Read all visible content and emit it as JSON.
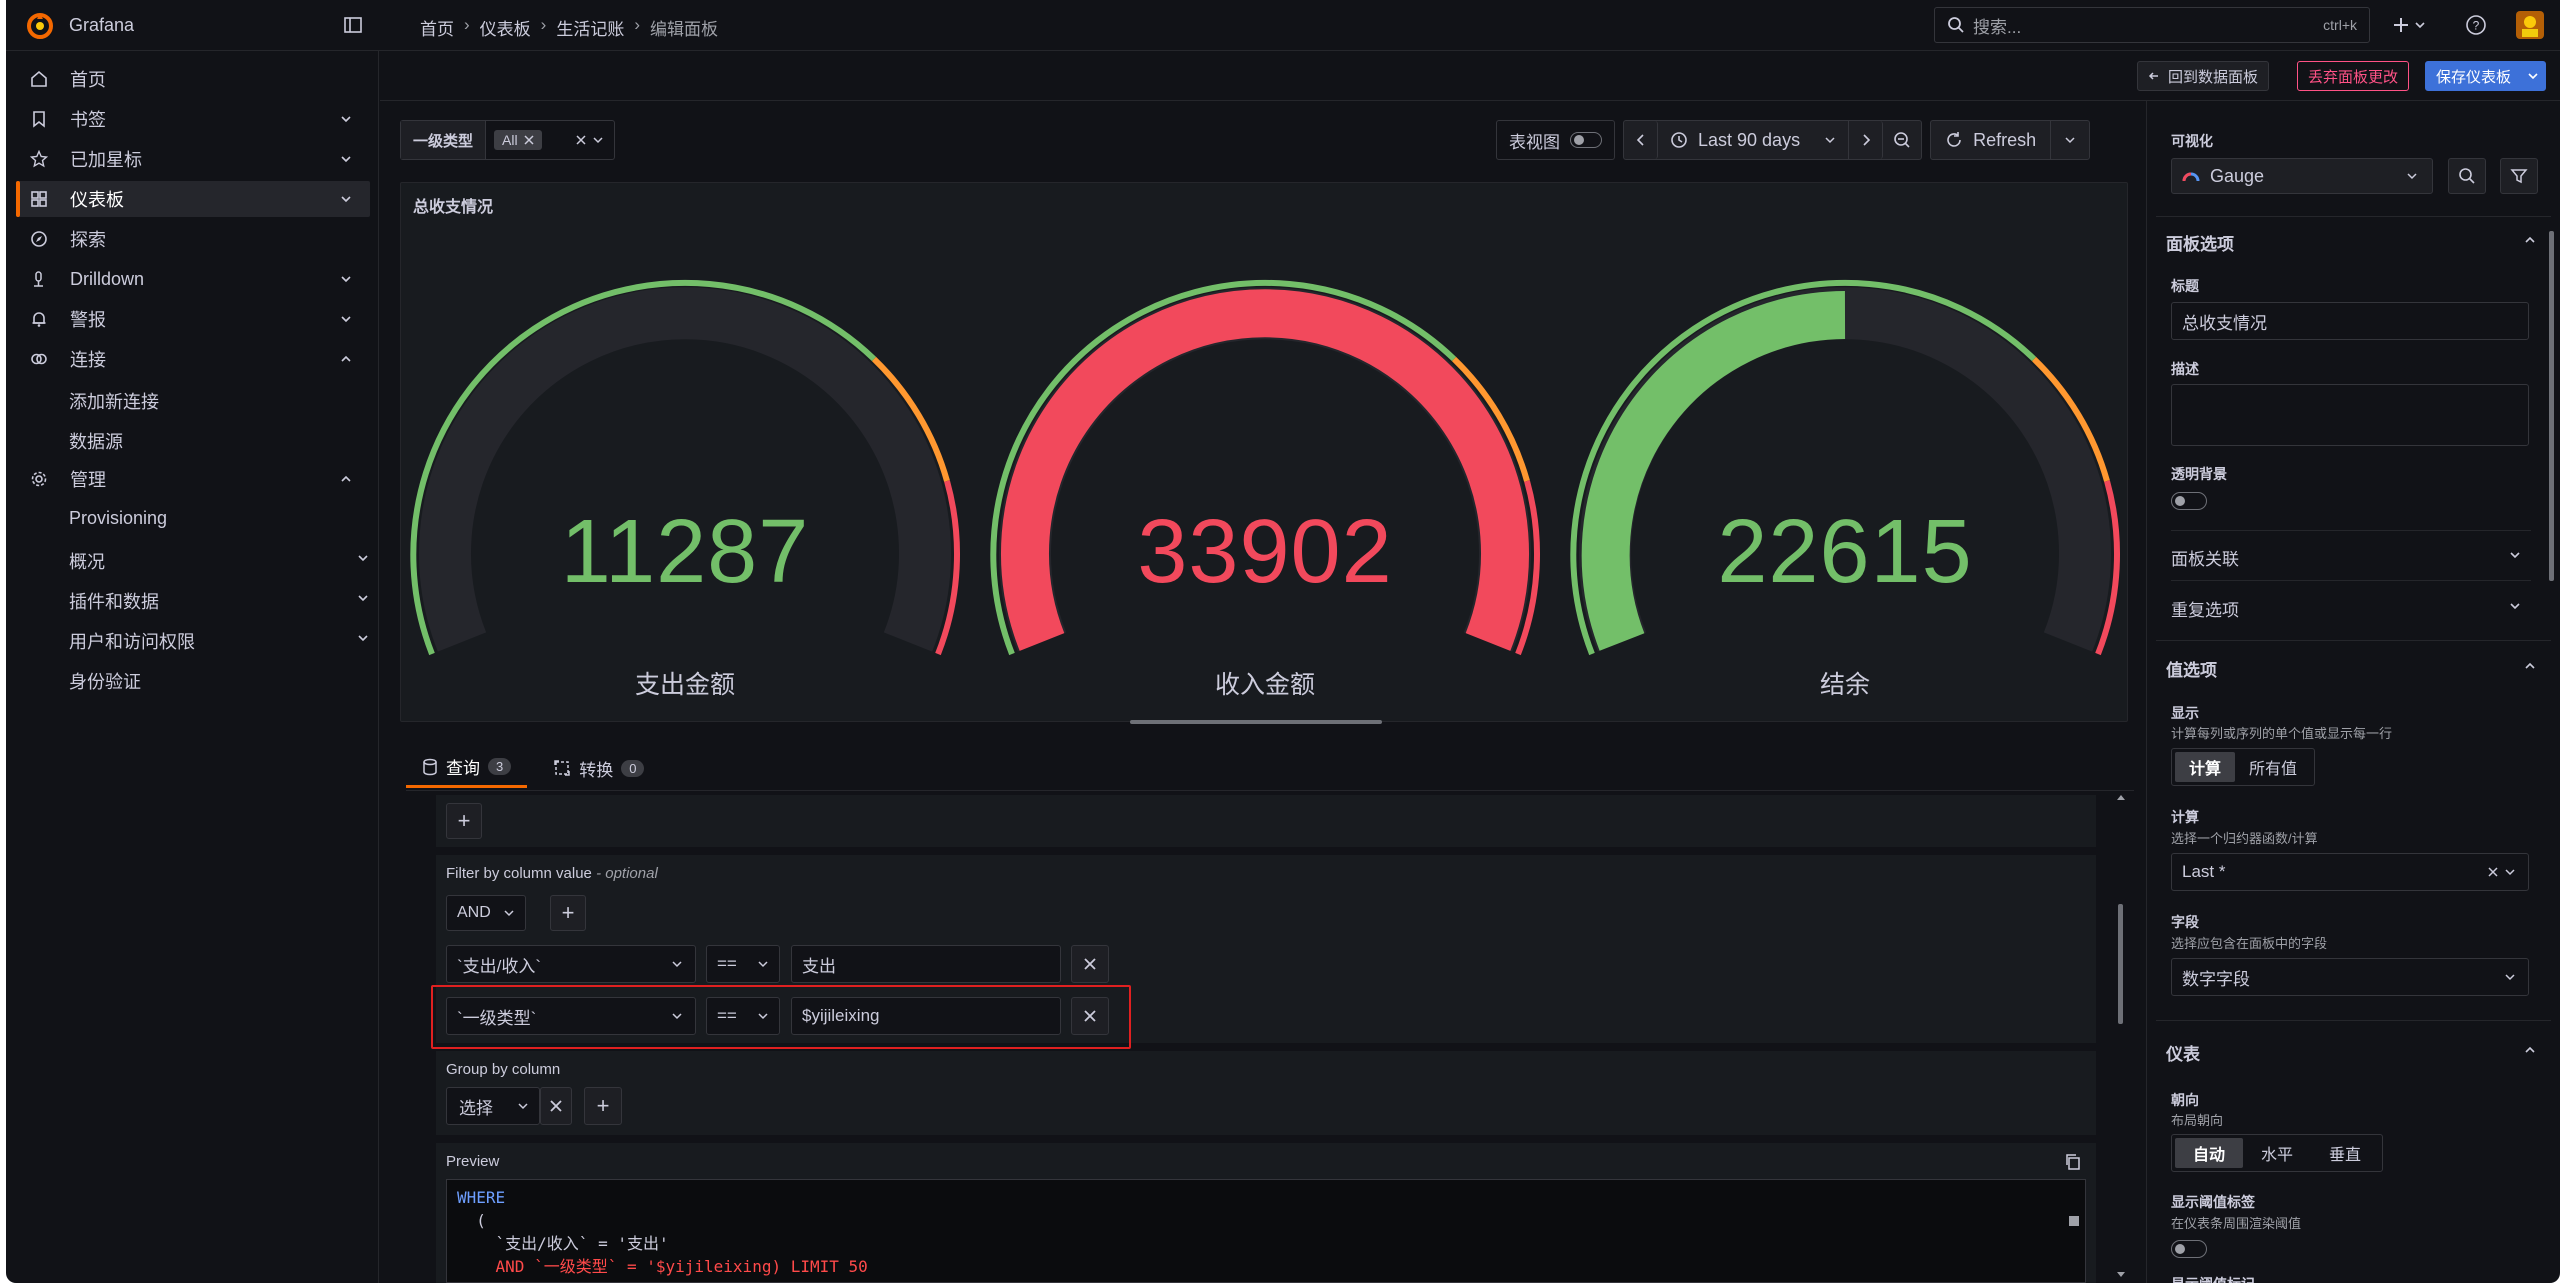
{
  "topbar": {
    "app_name": "Grafana",
    "breadcrumb": [
      "首页",
      "仪表板",
      "生活记账",
      "编辑面板"
    ],
    "search_placeholder": "搜索...",
    "search_shortcut": "ctrl+k"
  },
  "sidebar": {
    "items": [
      {
        "label": "首页",
        "icon": "home-icon"
      },
      {
        "label": "书签",
        "icon": "bookmark-icon"
      },
      {
        "label": "已加星标",
        "icon": "star-icon"
      },
      {
        "label": "仪表板",
        "icon": "dashboard-icon"
      },
      {
        "label": "探索",
        "icon": "compass-icon"
      },
      {
        "label": "Drilldown",
        "icon": "drilldown-icon"
      },
      {
        "label": "警报",
        "icon": "bell-icon"
      },
      {
        "label": "连接",
        "icon": "link-icon"
      }
    ],
    "connections_sub": [
      "添加新连接",
      "数据源"
    ],
    "admin": {
      "label": "管理",
      "icon": "gear-icon"
    },
    "admin_sub": [
      "Provisioning",
      "概况",
      "插件和数据",
      "用户和访问权限",
      "身份验证"
    ]
  },
  "actions": {
    "back": "回到数据面板",
    "discard": "丢弃面板更改",
    "save": "保存仪表板"
  },
  "toolbar": {
    "variable_label": "一级类型",
    "variable_value": "All",
    "table_view": "表视图",
    "time_range": "Last 90 days",
    "refresh": "Refresh"
  },
  "panel": {
    "title": "总收支情况",
    "gauges": [
      {
        "value": "11287",
        "label": "支出金额",
        "color": "#73bf69"
      },
      {
        "value": "33902",
        "label": "收入金额",
        "color": "#f2495c"
      },
      {
        "value": "22615",
        "label": "结余",
        "color": "#73bf69"
      }
    ]
  },
  "tabs": [
    {
      "label": "查询",
      "count": "3"
    },
    {
      "label": "转换",
      "count": "0"
    }
  ],
  "query": {
    "filter_title": "Filter by column value",
    "filter_optional": "- optional",
    "operator": "AND",
    "filters": [
      {
        "column": "`支出/收入`",
        "op": "==",
        "value": "支出"
      },
      {
        "column": "`一级类型`",
        "op": "==",
        "value": "$yijileixing"
      }
    ],
    "group_title": "Group by column",
    "group_select": "选择",
    "preview_title": "Preview",
    "preview_lines": [
      "WHERE",
      "  (",
      "    `支出/收入` = '支出'",
      "    AND `一级类型` = '$yijileixing) LIMIT 50"
    ]
  },
  "options": {
    "viz_label": "可视化",
    "viz_value": "Gauge",
    "panel_options": "面板选项",
    "title_label": "标题",
    "title_value": "总收支情况",
    "desc_label": "描述",
    "transparent_label": "透明背景",
    "panel_links": "面板关联",
    "repeat_options": "重复选项",
    "value_options": "值选项",
    "show_label": "显示",
    "show_desc": "计算每列或序列的单个值或显示每一行",
    "show_calc": "计算",
    "show_all": "所有值",
    "calc_label": "计算",
    "calc_desc": "选择一个归约器函数/计算",
    "calc_value": "Last *",
    "field_label": "字段",
    "field_desc": "选择应包含在面板中的字段",
    "field_value": "数字字段",
    "gauge_section": "仪表",
    "orient_label": "朝向",
    "orient_desc": "布局朝向",
    "orient_auto": "自动",
    "orient_h": "水平",
    "orient_v": "垂直",
    "threshold_labels": "显示阈值标签",
    "threshold_labels_desc": "在仪表条周围渲染阈值",
    "threshold_markers": "显示阈值标记"
  }
}
